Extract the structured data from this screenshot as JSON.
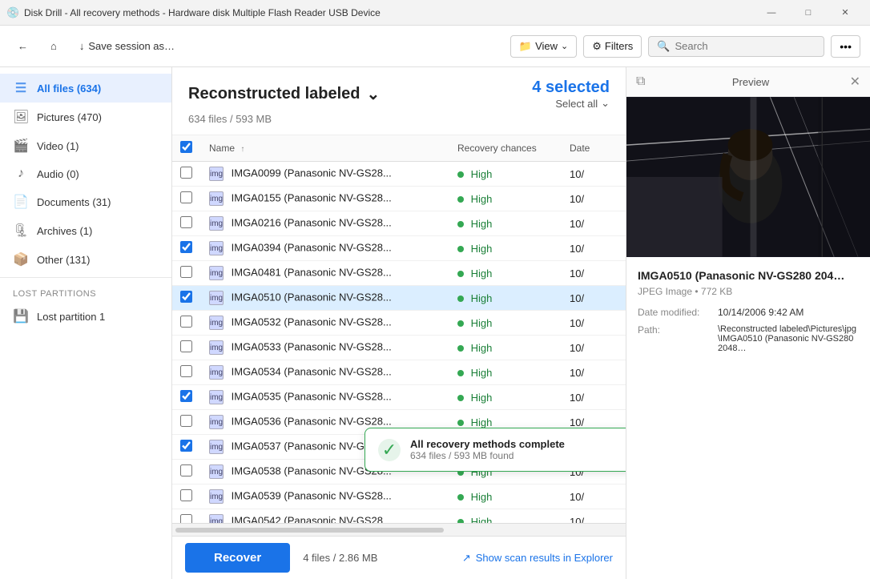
{
  "titlebar": {
    "title": "Disk Drill - All recovery methods - Hardware disk Multiple Flash Reader USB Device",
    "icon": "💿",
    "btn_min": "—",
    "btn_max": "□",
    "btn_close": "✕"
  },
  "toolbar": {
    "back_label": "←",
    "home_label": "⌂",
    "save_label": "↓",
    "save_session_label": "Save session as…",
    "view_label": "View",
    "filters_label": "Filters",
    "search_placeholder": "Search",
    "more_label": "•••"
  },
  "sidebar": {
    "items": [
      {
        "id": "all-files",
        "icon": "☰",
        "label": "All files (634)",
        "active": true
      },
      {
        "id": "pictures",
        "icon": "🖼",
        "label": "Pictures (470)",
        "active": false
      },
      {
        "id": "video",
        "icon": "🎬",
        "label": "Video (1)",
        "active": false
      },
      {
        "id": "audio",
        "icon": "♪",
        "label": "Audio (0)",
        "active": false
      },
      {
        "id": "documents",
        "icon": "📄",
        "label": "Documents (31)",
        "active": false
      },
      {
        "id": "archives",
        "icon": "🗜",
        "label": "Archives (1)",
        "active": false
      },
      {
        "id": "other",
        "icon": "📦",
        "label": "Other (131)",
        "active": false
      }
    ],
    "lost_partitions_section": "Lost partitions",
    "lost_partitions": [
      {
        "id": "lost-partition-1",
        "icon": "💾",
        "label": "Lost partition 1"
      }
    ]
  },
  "content": {
    "title": "Reconstructed labeled",
    "title_chevron": "⌄",
    "selected_label": "4 selected",
    "select_all_label": "Select all",
    "select_all_chevron": "⌄",
    "subtitle": "634 files / 593 MB",
    "columns": {
      "name": "Name",
      "recovery": "Recovery chances",
      "date": "Date"
    },
    "sort_arrow": "↑"
  },
  "files": [
    {
      "id": "f1",
      "name": "IMGA0099 (Panasonic NV-GS28...",
      "recovery": "High",
      "date": "10/",
      "checked": false,
      "selected": false
    },
    {
      "id": "f2",
      "name": "IMGA0155 (Panasonic NV-GS28...",
      "recovery": "High",
      "date": "10/",
      "checked": false,
      "selected": false
    },
    {
      "id": "f3",
      "name": "IMGA0216 (Panasonic NV-GS28...",
      "recovery": "High",
      "date": "10/",
      "checked": false,
      "selected": false
    },
    {
      "id": "f4",
      "name": "IMGA0394 (Panasonic NV-GS28...",
      "recovery": "High",
      "date": "10/",
      "checked": true,
      "selected": false
    },
    {
      "id": "f5",
      "name": "IMGA0481 (Panasonic NV-GS28...",
      "recovery": "High",
      "date": "10/",
      "checked": false,
      "selected": false
    },
    {
      "id": "f6",
      "name": "IMGA0510 (Panasonic NV-GS28...",
      "recovery": "High",
      "date": "10/",
      "checked": true,
      "selected": true
    },
    {
      "id": "f7",
      "name": "IMGA0532 (Panasonic NV-GS28...",
      "recovery": "High",
      "date": "10/",
      "checked": false,
      "selected": false
    },
    {
      "id": "f8",
      "name": "IMGA0533 (Panasonic NV-GS28...",
      "recovery": "High",
      "date": "10/",
      "checked": false,
      "selected": false
    },
    {
      "id": "f9",
      "name": "IMGA0534 (Panasonic NV-GS28...",
      "recovery": "High",
      "date": "10/",
      "checked": false,
      "selected": false
    },
    {
      "id": "f10",
      "name": "IMGA0535 (Panasonic NV-GS28...",
      "recovery": "High",
      "date": "10/",
      "checked": true,
      "selected": false
    },
    {
      "id": "f11",
      "name": "IMGA0536 (Panasonic NV-GS28...",
      "recovery": "High",
      "date": "10/",
      "checked": false,
      "selected": false
    },
    {
      "id": "f12",
      "name": "IMGA0537 (Panasonic NV-GS28...",
      "recovery": "High",
      "date": "10/",
      "checked": true,
      "selected": false
    },
    {
      "id": "f13",
      "name": "IMGA0538 (Panasonic NV-GS28...",
      "recovery": "High",
      "date": "10/",
      "checked": false,
      "selected": false
    },
    {
      "id": "f14",
      "name": "IMGA0539 (Panasonic NV-GS28...",
      "recovery": "High",
      "date": "10/",
      "checked": false,
      "selected": false
    },
    {
      "id": "f15",
      "name": "IMGA0542 (Panasonic NV-GS28...",
      "recovery": "High",
      "date": "10/",
      "checked": false,
      "selected": false
    }
  ],
  "preview": {
    "title": "Preview",
    "filename": "IMGA0510 (Panasonic NV-GS280 204…",
    "filetype": "JPEG Image • 772 KB",
    "date_label": "Date modified:",
    "date_value": "10/14/2006 9:42 AM",
    "path_label": "Path:",
    "path_value": "\\Reconstructed labeled\\Pictures\\jpg\\IMGA0510 (Panasonic NV-GS280 2048…"
  },
  "notification": {
    "icon": "✓",
    "title": "All recovery methods complete",
    "subtitle": "634 files / 593 MB found",
    "close": "✕"
  },
  "bottom": {
    "recover_label": "Recover",
    "file_info": "4 files / 2.86 MB",
    "explorer_label": "Show scan results in Explorer"
  },
  "colors": {
    "accent": "#1a73e8",
    "high_green": "#34a853",
    "selected_row": "#cce5ff"
  }
}
